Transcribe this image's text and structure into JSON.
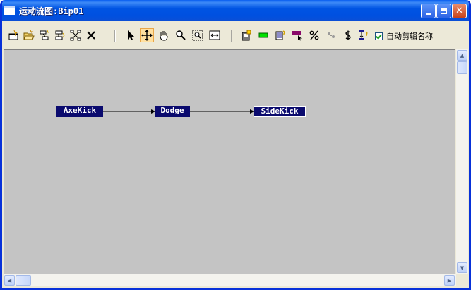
{
  "window": {
    "title": "运动流图:Bip01",
    "controls": {
      "minimize": "minimize",
      "maximize": "maximize",
      "close": "✕"
    }
  },
  "toolbar": {
    "tools": [
      {
        "name": "new-script-icon",
        "active": false
      },
      {
        "name": "open-file-icon",
        "active": false
      },
      {
        "name": "add-clip-icon",
        "active": false
      },
      {
        "name": "add-transition-icon",
        "active": false
      },
      {
        "name": "show-graph-icon",
        "active": false
      },
      {
        "name": "delete-icon",
        "active": false
      },
      {
        "name": "select-arrow-icon",
        "active": false
      },
      {
        "name": "move-icon",
        "active": true
      },
      {
        "name": "pan-hand-icon",
        "active": false
      },
      {
        "name": "zoom-icon",
        "active": false
      },
      {
        "name": "zoom-region-icon",
        "active": false
      },
      {
        "name": "zoom-extents-icon",
        "active": false
      },
      {
        "name": "save-motion-icon",
        "active": false
      },
      {
        "name": "green-clip-icon",
        "active": false
      },
      {
        "name": "clip-properties-icon",
        "active": false
      },
      {
        "name": "pick-clip-icon",
        "active": false
      },
      {
        "name": "percent-icon",
        "active": false
      },
      {
        "name": "random-icon",
        "active": false
      },
      {
        "name": "dollar-icon",
        "active": false
      },
      {
        "name": "optimize-transition-icon",
        "active": false
      }
    ],
    "auto_clip_names": {
      "checked": true,
      "label": "自动剪辑名称"
    }
  },
  "graph": {
    "nodes": [
      {
        "id": "n1",
        "label": "AxeKick",
        "selected": false
      },
      {
        "id": "n2",
        "label": "Dodge",
        "selected": false
      },
      {
        "id": "n3",
        "label": "SideKick",
        "selected": true
      }
    ],
    "links": [
      {
        "from": "AxeKick",
        "to": "Dodge"
      },
      {
        "from": "Dodge",
        "to": "SideKick"
      }
    ]
  },
  "colors": {
    "canvas_bg": "#c4c4c4",
    "node_bg": "#0a0a6e",
    "node_text": "#ffffff",
    "titlebar": "#0054e3"
  }
}
